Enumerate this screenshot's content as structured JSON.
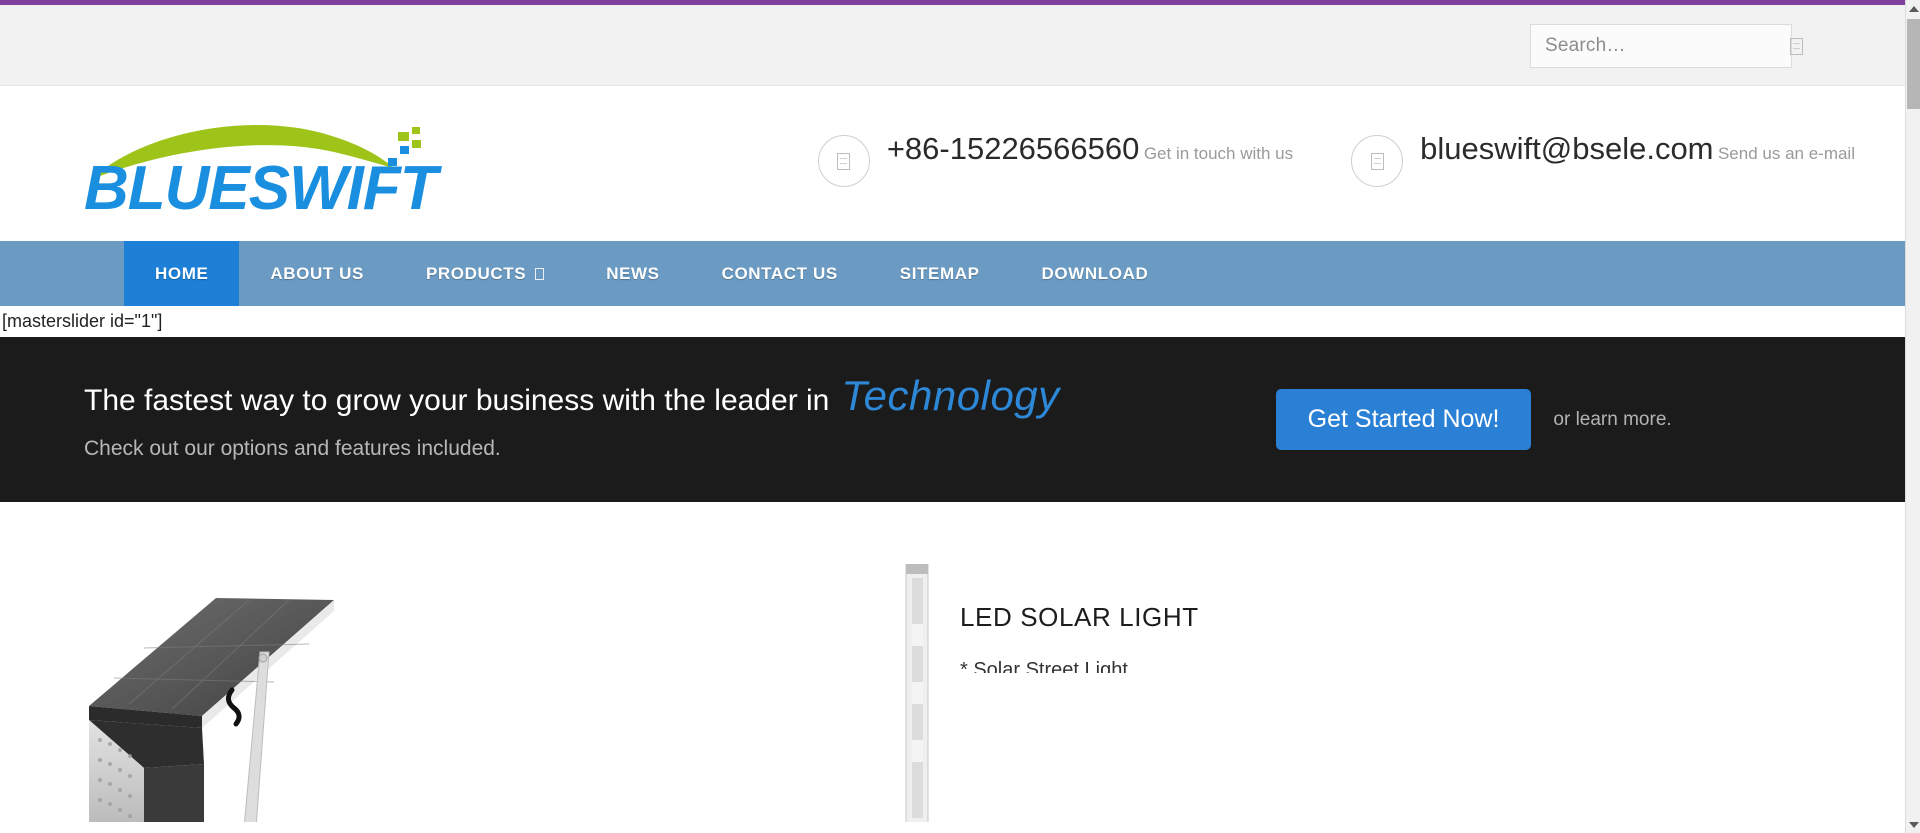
{
  "browser": {
    "accent_color": "#7e3f9d",
    "scrollbar": {
      "up_arrow": "scroll-up-arrow",
      "down_arrow": "scroll-down-arrow"
    }
  },
  "topbar": {
    "search": {
      "placeholder": "Search…",
      "value": "",
      "icon": "search-glyph-placeholder"
    }
  },
  "header": {
    "logo": {
      "text": "BLUESWIFT",
      "text_color": "#1a8fe0",
      "swoosh_color": "#9ec41a"
    },
    "contacts": [
      {
        "icon": "phone-icon",
        "primary": "+86-15226566560",
        "secondary": "Get in touch with us"
      },
      {
        "icon": "envelope-icon",
        "primary": "blueswift@bsele.com",
        "secondary": "Send us an e-mail"
      }
    ]
  },
  "nav": {
    "background": "#6b9bc3",
    "active_background": "#1d7fd6",
    "items": [
      {
        "label": "HOME",
        "active": true,
        "has_caret": false
      },
      {
        "label": "ABOUT US",
        "active": false,
        "has_caret": false
      },
      {
        "label": "PRODUCTS",
        "active": false,
        "has_caret": true
      },
      {
        "label": "NEWS",
        "active": false,
        "has_caret": false
      },
      {
        "label": "CONTACT US",
        "active": false,
        "has_caret": false
      },
      {
        "label": "SITEMAP",
        "active": false,
        "has_caret": false
      },
      {
        "label": "DOWNLOAD",
        "active": false,
        "has_caret": false
      }
    ]
  },
  "shortcode": {
    "text": "[masterslider id=\"1\"]"
  },
  "promo": {
    "background": "#1b1b1b",
    "headline_prefix": "The fastest way to grow your business with the leader in",
    "headline_accent": "Technology",
    "accent_color": "#2e88d8",
    "subhead": "Check out our options and features included.",
    "cta_label": "Get Started Now!",
    "cta_color": "#2980d4",
    "cta_note": "or learn more."
  },
  "products": {
    "item": {
      "title": "LED SOLAR LIGHT",
      "bullet": "* Solar Street Light",
      "image_alt": "led-solar-street-light-photo"
    }
  }
}
